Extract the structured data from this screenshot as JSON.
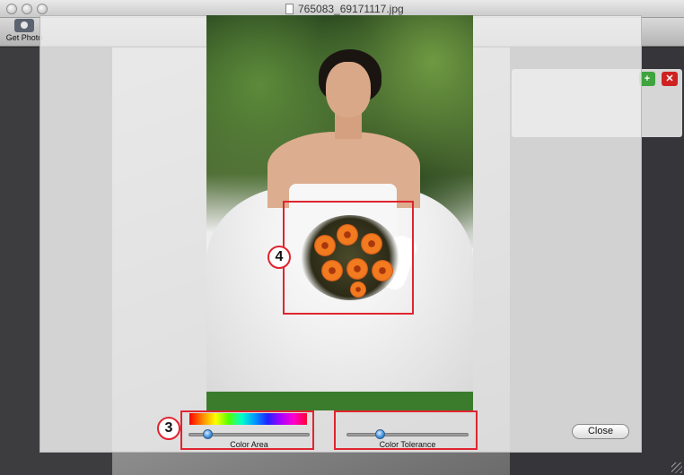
{
  "window": {
    "title": "765083_69171117.jpg"
  },
  "toolbar": {
    "get_photo_label": "Get Photo"
  },
  "sheet": {
    "callouts": {
      "selection": "4",
      "controls": "3"
    },
    "color_area": {
      "label": "Color Area",
      "slider_value": 0.12
    },
    "color_tolerance": {
      "label": "Color Tolerance",
      "slider_value": 0.27
    },
    "close_label": "Close"
  },
  "colors": {
    "highlight": "#e0242f",
    "slider_knob": "#3a8ddc",
    "add_button": "#3fa33f",
    "delete_button": "#cf2222"
  },
  "icons": {
    "get_photo": "camera-icon",
    "document": "document-icon",
    "add": "plus-icon",
    "delete": "close-x-icon"
  }
}
